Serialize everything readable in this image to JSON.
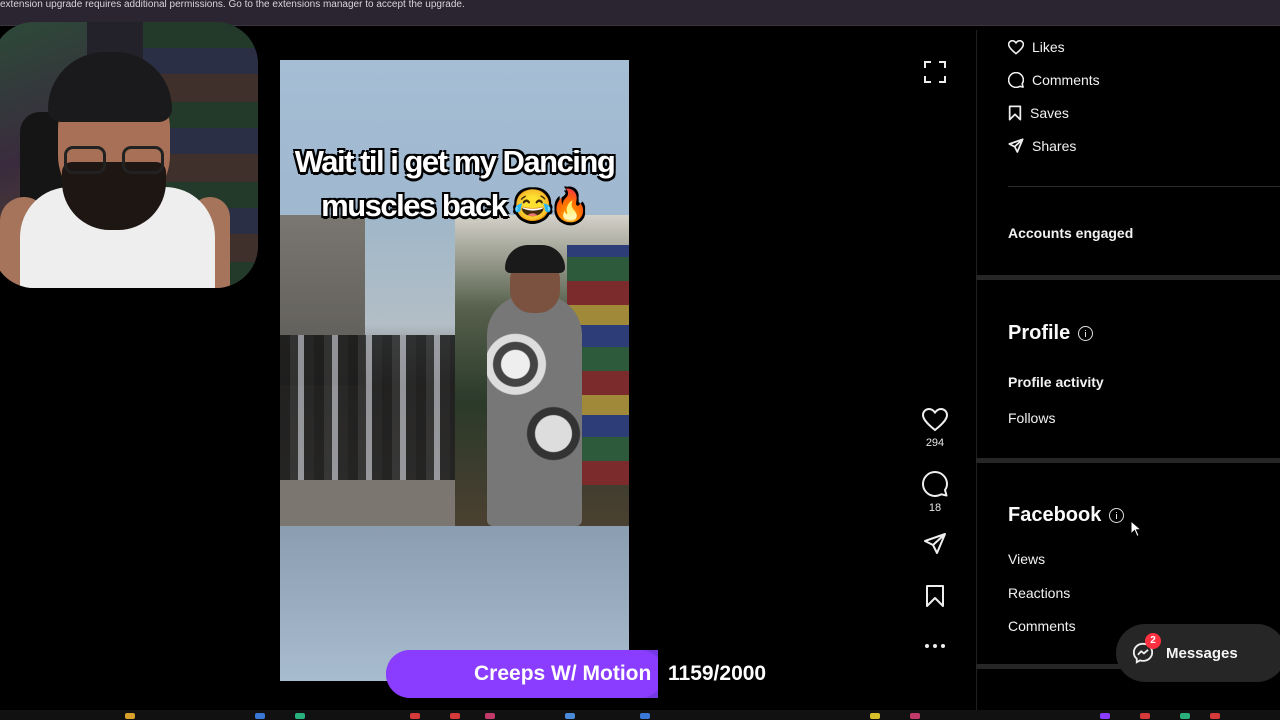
{
  "banner": {
    "text": "extension upgrade requires additional permissions. Go to the extensions manager to accept the upgrade."
  },
  "video": {
    "caption_line1": "Wait til i get my Dancing",
    "caption_line2": "muscles back 😂🔥"
  },
  "actions": {
    "likes_count": "294",
    "comments_count": "18",
    "icons": [
      "fullscreen-icon",
      "heart-icon",
      "comment-icon",
      "send-icon",
      "bookmark-icon",
      "more-icon"
    ]
  },
  "insights": {
    "interactions": [
      {
        "label": "Likes",
        "icon": "heart-icon"
      },
      {
        "label": "Comments",
        "icon": "comment-icon"
      },
      {
        "label": "Saves",
        "icon": "bookmark-icon"
      },
      {
        "label": "Shares",
        "icon": "send-icon"
      }
    ],
    "accounts_engaged": "Accounts engaged",
    "profile": {
      "heading": "Profile",
      "items": [
        "Profile activity",
        "Follows"
      ]
    },
    "facebook": {
      "heading": "Facebook",
      "items": [
        "Views",
        "Reactions",
        "Comments"
      ]
    }
  },
  "messages": {
    "label": "Messages",
    "badge": "2"
  },
  "progress": {
    "title": "Creeps W/ Motion",
    "count": "1159/2000",
    "value_fraction": 0.58,
    "color": "#8a3cff"
  },
  "colors": {
    "background": "#000000",
    "accent_purple": "#8a3cff",
    "badge_red": "#ff3040"
  }
}
